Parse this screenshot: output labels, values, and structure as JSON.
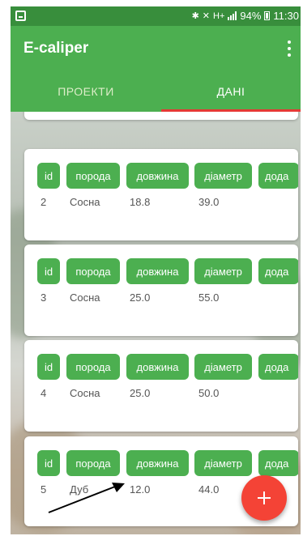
{
  "status_bar": {
    "battery": "94%",
    "time": "11:30",
    "signal_label": "H+"
  },
  "app_bar": {
    "title": "E-caliper",
    "menu_icon": "more-vert-icon"
  },
  "tabs": [
    {
      "label": "ПРОЕКТИ",
      "selected": false
    },
    {
      "label": "ДАНІ",
      "selected": true
    }
  ],
  "colors": {
    "primary": "#4caf50",
    "status_bar": "#388e3c",
    "accent": "#f44336",
    "tab_indicator": "#e53935"
  },
  "columns": [
    "id",
    "порода",
    "довжина",
    "діаметр",
    "дода"
  ],
  "rows": [
    {
      "id": "2",
      "species": "Сосна",
      "length": "18.8",
      "diameter": "39.0"
    },
    {
      "id": "3",
      "species": "Сосна",
      "length": "25.0",
      "diameter": "55.0"
    },
    {
      "id": "4",
      "species": "Сосна",
      "length": "25.0",
      "diameter": "50.0"
    },
    {
      "id": "5",
      "species": "Дуб",
      "length": "12.0",
      "diameter": "44.0"
    }
  ],
  "fab": {
    "icon": "plus-icon"
  }
}
